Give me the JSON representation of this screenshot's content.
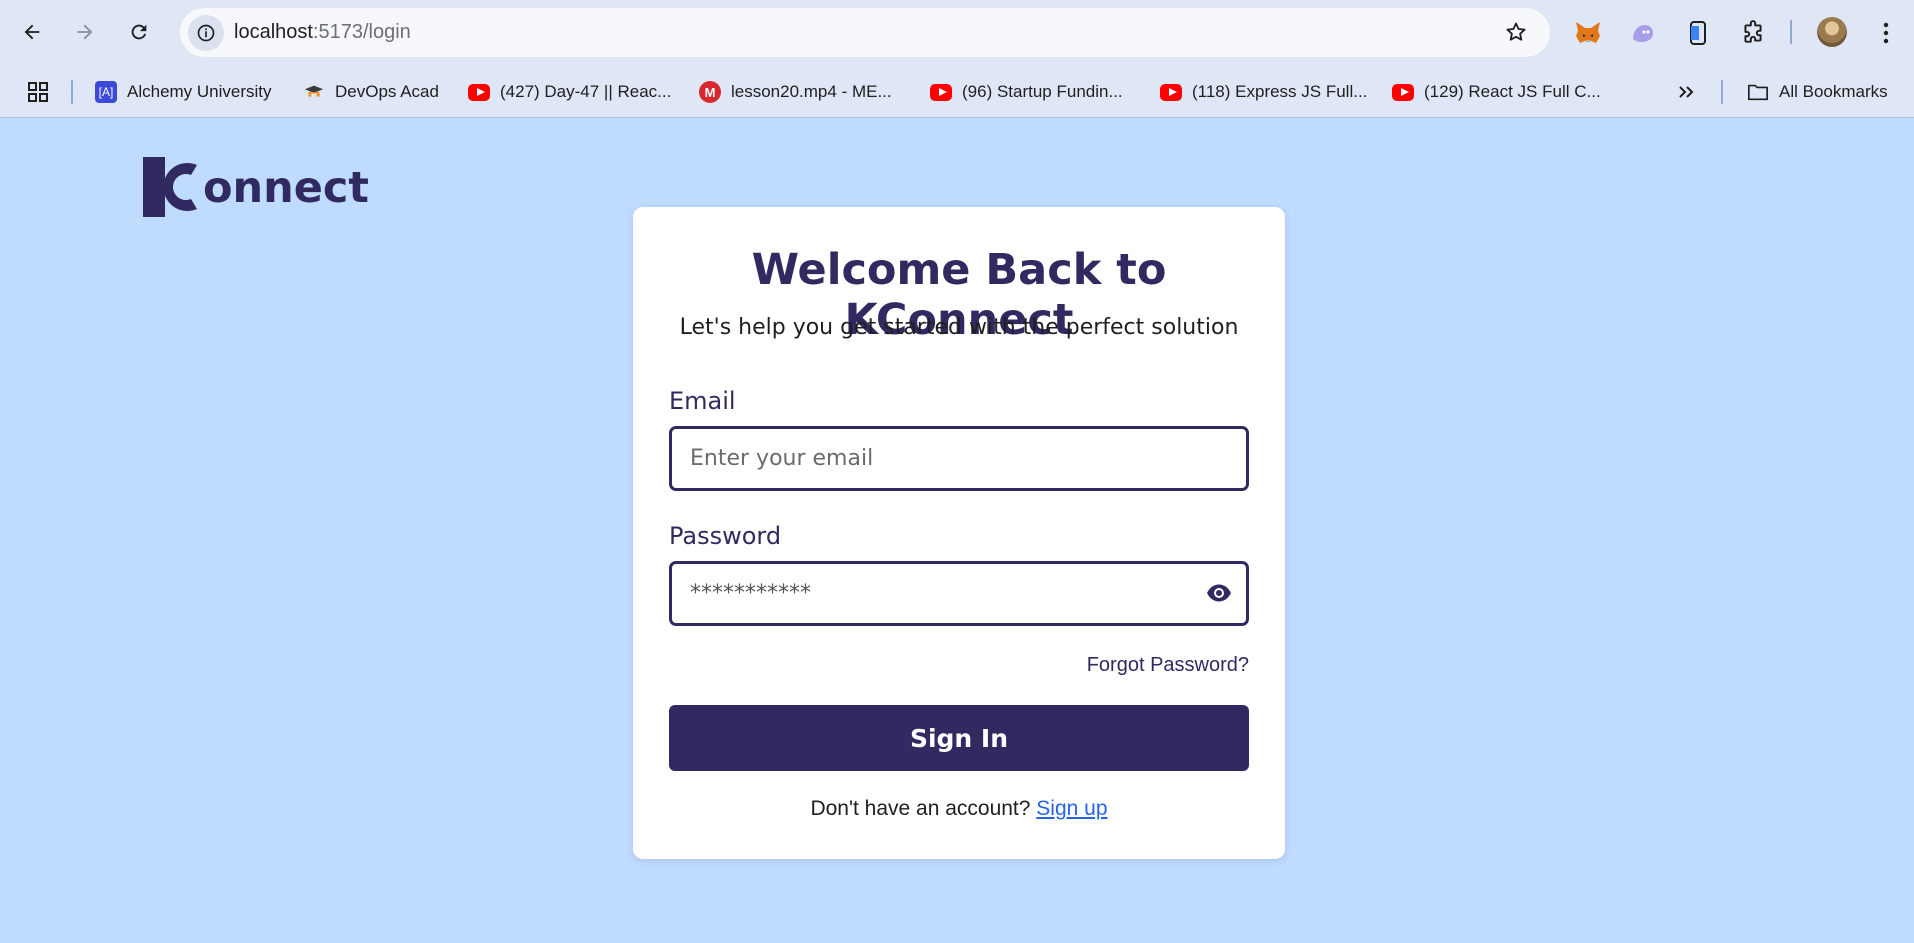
{
  "browser": {
    "url_host": "localhost",
    "url_path": ":5173/login",
    "bookmarks": [
      {
        "label": "Alchemy University",
        "icon": "alchemy-icon"
      },
      {
        "label": "DevOps Acad",
        "icon": "devops-icon"
      },
      {
        "label": "(427) Day-47 || Reac...",
        "icon": "youtube-icon"
      },
      {
        "label": "lesson20.mp4 - ME...",
        "icon": "mega-icon"
      },
      {
        "label": "(96) Startup Fundin...",
        "icon": "youtube-icon"
      },
      {
        "label": "(118) Express JS Full...",
        "icon": "youtube-icon"
      },
      {
        "label": "(129) React JS Full C...",
        "icon": "youtube-icon"
      }
    ],
    "all_bookmarks_label": "All Bookmarks",
    "alchemy_fav_text": "[A]",
    "mega_fav_text": "M"
  },
  "brand": {
    "logo_text": "Konnect",
    "color": "#312a60"
  },
  "login": {
    "title": "Welcome Back to KConnect",
    "subtitle": "Let's help you get started with the perfect solution",
    "email_label": "Email",
    "email_placeholder": "Enter your email",
    "email_value": "",
    "password_label": "Password",
    "password_value_masked": "***********",
    "forgot_password": "Forgot Password?",
    "sign_in": "Sign In",
    "no_account": "Don't have an account?",
    "sign_up": "Sign up"
  },
  "colors": {
    "page_background": "#bfdbfe",
    "primary": "#312a60",
    "link": "#2563eb"
  }
}
